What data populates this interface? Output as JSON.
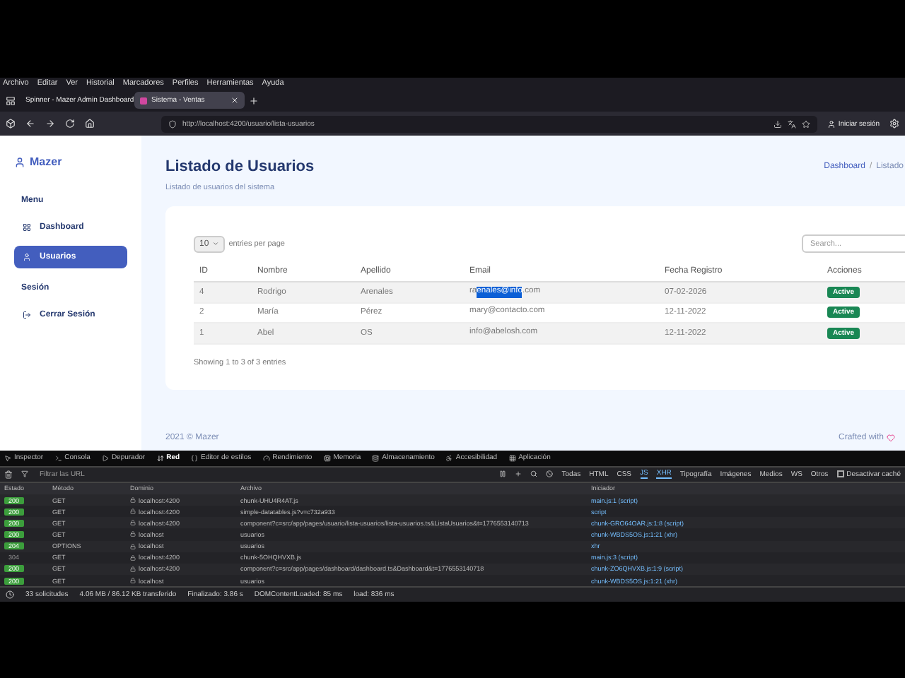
{
  "menu_bar": [
    "Archivo",
    "Editar",
    "Ver",
    "Historial",
    "Marcadores",
    "Perfiles",
    "Herramientas",
    "Ayuda"
  ],
  "tabs": [
    {
      "label": "Spinner - Mazer Admin Dashboard",
      "selected": false
    },
    {
      "label": "Sistema - Ventas",
      "selected": true
    }
  ],
  "address_bar": {
    "url": "http://localhost:4200/usuario/lista-usuarios",
    "account": "Iniciar sesión"
  },
  "sidebar": {
    "logo": "Mazer",
    "sections": [
      {
        "title": "Menu",
        "items": [
          {
            "label": "Dashboard",
            "selected": false
          },
          {
            "label": "Usuarios",
            "selected": true
          }
        ]
      },
      {
        "title": "Sesión",
        "items": [
          {
            "label": "Cerrar Sesión",
            "selected": false
          }
        ]
      }
    ]
  },
  "page": {
    "title": "Listado de Usuarios",
    "subtitle": "Listado de usuarios del sistema",
    "breadcrumb": {
      "items": [
        "Dashboard",
        "Listado"
      ],
      "separator": "/"
    }
  },
  "table": {
    "page_size": "10",
    "page_size_label": "entries per page",
    "search_placeholder": "Search...",
    "columns": [
      "ID",
      "Nombre",
      "Apellido",
      "Email",
      "Fecha Registro",
      "Acciones"
    ],
    "rows": [
      {
        "id": "4",
        "nombre": "Rodrigo",
        "apellido": "Arenales",
        "email": [
          {
            "text": "ra",
            "selected": false
          },
          {
            "text": "enales@info",
            "selected": true
          },
          {
            "text": ".com",
            "selected": false
          }
        ],
        "fecha": "07-02-2026",
        "status": "Active"
      },
      {
        "id": "2",
        "nombre": "María",
        "apellido": "Pérez",
        "email": [
          {
            "text": "mary@contacto.com",
            "selected": false
          }
        ],
        "fecha": "12-11-2022",
        "status": "Active"
      },
      {
        "id": "1",
        "nombre": "Abel",
        "apellido": "OS",
        "email": [
          {
            "text": "info@abelosh.com",
            "selected": false
          }
        ],
        "fecha": "12-11-2022",
        "status": "Active"
      }
    ],
    "info": "Showing 1 to 3 of 3 entries"
  },
  "footer": {
    "left": "2021 © Mazer",
    "right": "Crafted with"
  },
  "devtools": {
    "tabs": [
      {
        "label": "Inspector",
        "selected": false
      },
      {
        "label": "Consola",
        "selected": false
      },
      {
        "label": "Depurador",
        "selected": false
      },
      {
        "label": "Red",
        "selected": true
      },
      {
        "label": "Editor de estilos",
        "selected": false
      },
      {
        "label": "Rendimiento",
        "selected": false
      },
      {
        "label": "Memoria",
        "selected": false
      },
      {
        "label": "Almacenamiento",
        "selected": false
      },
      {
        "label": "Accesibilidad",
        "selected": false
      },
      {
        "label": "Aplicación",
        "selected": false
      }
    ],
    "filter_placeholder": "Filtrar las URL",
    "type_filters": [
      {
        "label": "Todas",
        "selected": false
      },
      {
        "label": "HTML",
        "selected": false
      },
      {
        "label": "CSS",
        "selected": false
      },
      {
        "label": "JS",
        "selected": true
      },
      {
        "label": "XHR",
        "selected": true
      },
      {
        "label": "Tipografía",
        "selected": false
      },
      {
        "label": "Imágenes",
        "selected": false
      },
      {
        "label": "Medios",
        "selected": false
      },
      {
        "label": "WS",
        "selected": false
      },
      {
        "label": "Otros",
        "selected": false
      }
    ],
    "disable_cache": {
      "label": "Desactivar caché",
      "checked": false
    },
    "columns": [
      "Estado",
      "Método",
      "Dominio",
      "Archivo",
      "Iniciador"
    ],
    "requests": [
      {
        "status": "200",
        "ok": true,
        "method": "GET",
        "domain": "localhost:4200",
        "file": "chunk-UHU4R4AT.js",
        "initiator": "main.js:1 (script)"
      },
      {
        "status": "200",
        "ok": true,
        "method": "GET",
        "domain": "localhost:4200",
        "file": "simple-datatables.js?v=c732a933",
        "initiator": "script"
      },
      {
        "status": "200",
        "ok": true,
        "method": "GET",
        "domain": "localhost:4200",
        "file": "component?c=src/app/pages/usuario/lista-usuarios/lista-usuarios.ts&ListaUsuarios&t=1776553140713",
        "initiator": "chunk-GRO64OAR.js:1:8 (script)"
      },
      {
        "status": "200",
        "ok": true,
        "method": "GET",
        "domain": "localhost",
        "file": "usuarios",
        "initiator": "chunk-WBDS5OS.js:1:21 (xhr)"
      },
      {
        "status": "204",
        "ok": true,
        "method": "OPTIONS",
        "domain": "localhost",
        "file": "usuarios",
        "initiator": "xhr"
      },
      {
        "status": "304",
        "ok": false,
        "method": "GET",
        "domain": "localhost:4200",
        "file": "chunk-5OHQHVXB.js",
        "initiator": "main.js:3 (script)"
      },
      {
        "status": "200",
        "ok": true,
        "method": "GET",
        "domain": "localhost:4200",
        "file": "component?c=src/app/pages/dashboard/dashboard.ts&Dashboard&t=1776553140718",
        "initiator": "chunk-ZO6QHVXB.js:1:9 (script)"
      },
      {
        "status": "200",
        "ok": true,
        "method": "GET",
        "domain": "localhost",
        "file": "usuarios",
        "initiator": "chunk-WBDS5OS.js:1:21 (xhr)"
      }
    ],
    "summary": [
      "33 solicitudes",
      "4.06 MB / 86.12 KB transferido",
      "Finalizado: 3.86 s",
      "DOMContentLoaded: 85 ms",
      "load: 836 ms"
    ]
  }
}
